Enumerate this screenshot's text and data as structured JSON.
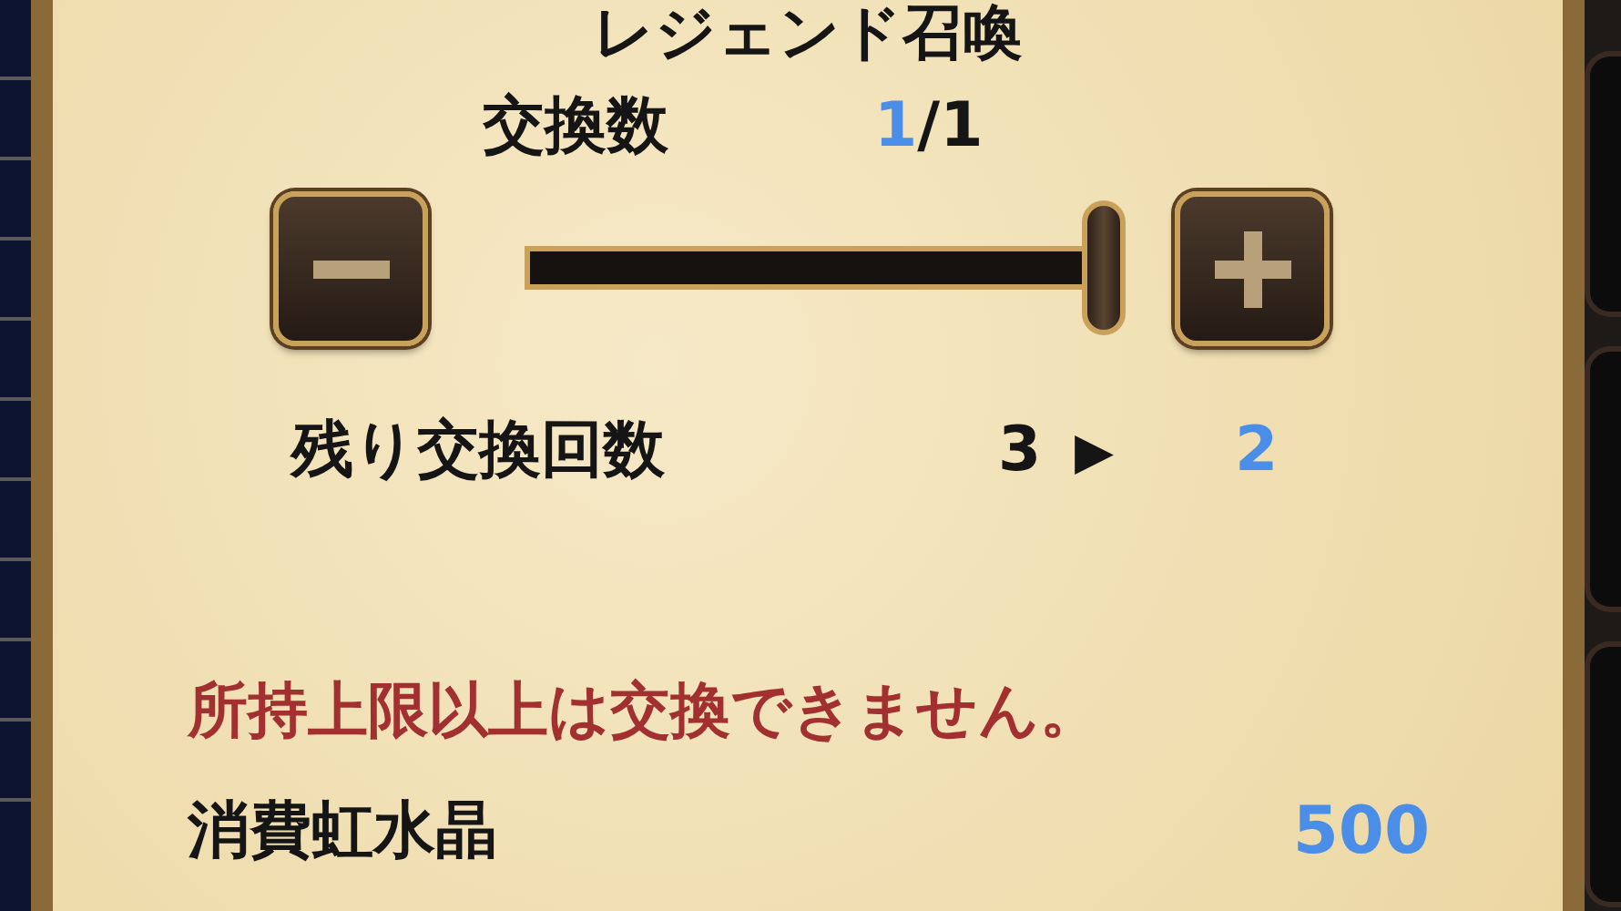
{
  "title": "レジェンド召喚",
  "exchange_count": {
    "label": "交換数",
    "current": "1",
    "total": "/1"
  },
  "slider": {
    "level": 1
  },
  "remaining": {
    "label": "残り交換回数",
    "before": "3",
    "arrow": "▶",
    "after": "2"
  },
  "warning": "所持上限以上は交換できません。",
  "cost": {
    "label": "消費虹水晶",
    "value": "500"
  }
}
